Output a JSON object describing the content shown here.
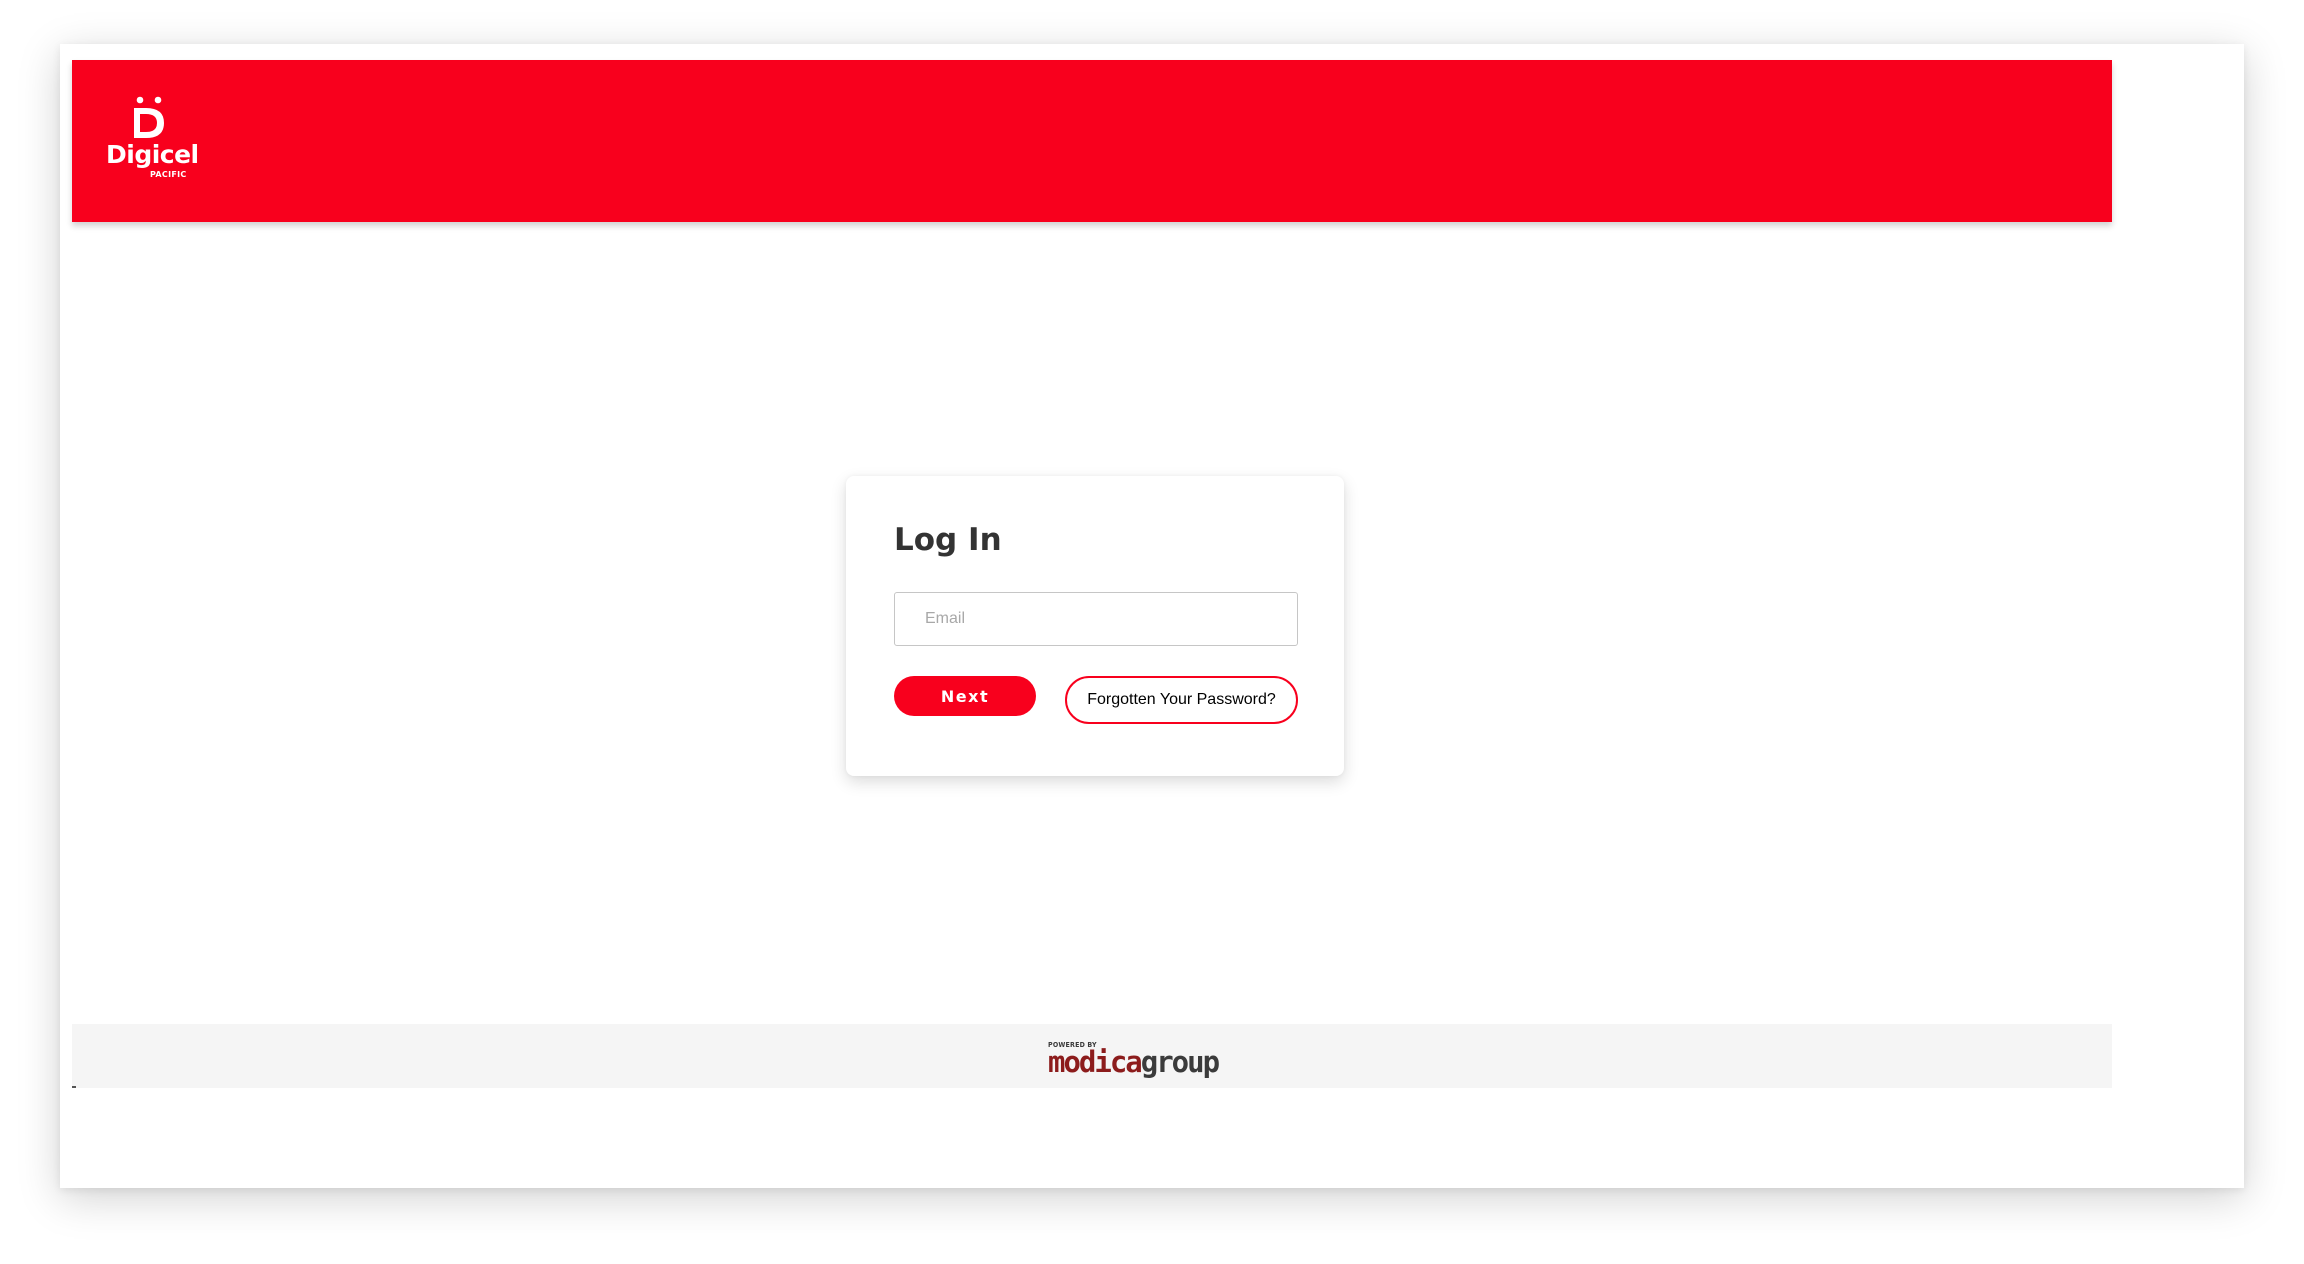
{
  "header": {
    "logo": {
      "icon": "digicel-smile-icon",
      "name": "Digicel",
      "subtitle": "PACIFIC"
    }
  },
  "login": {
    "title": "Log In",
    "email": {
      "placeholder": "Email",
      "value": ""
    },
    "next_label": "Next",
    "forgot_label": "Forgotten Your Password?"
  },
  "footer": {
    "powered_by": "POWERED BY",
    "brand_part1": "modica",
    "brand_part2": "group"
  },
  "colors": {
    "brand_red": "#f8001d",
    "page_background": "#ffffff",
    "footer_background": "#f5f5f5",
    "modica_red": "#8c1c1c",
    "group_gray": "#3b3b3b"
  }
}
